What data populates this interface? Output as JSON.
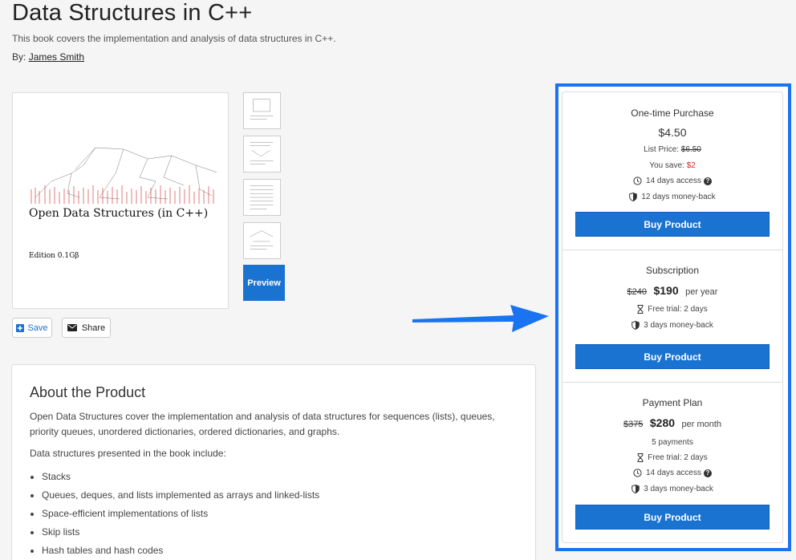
{
  "header": {
    "title": "Data Structures in C++",
    "subtitle": "This book covers the implementation and analysis of data structures in C++.",
    "author_prefix": "By:",
    "author": "James Smith"
  },
  "cover": {
    "title": "Open Data Structures (in C++)",
    "edition": "Edition 0.1Gβ"
  },
  "gallery": {
    "preview_label": "Preview"
  },
  "actions": {
    "save_label": "Save",
    "share_label": "Share"
  },
  "about": {
    "heading": "About the Product",
    "description": "Open Data Structures cover the implementation and analysis of data structures for sequences (lists), queues, priority queues, unordered dictionaries, ordered dictionaries, and graphs.",
    "list_intro": "Data structures presented in the book include:",
    "items": [
      "Stacks",
      "Queues, deques, and lists implemented as arrays and linked-lists",
      "Space-efficient implementations of lists",
      "Skip lists",
      "Hash tables and hash codes"
    ]
  },
  "pricing": {
    "accent": "#1a73d1",
    "one_time": {
      "name": "One-time Purchase",
      "price": "$4.50",
      "list_price_label": "List Price:",
      "list_price": "$6.50",
      "you_save_label": "You save:",
      "you_save": "$2",
      "access": "14 days access",
      "money_back": "12 days money-back",
      "button": "Buy Product"
    },
    "subscription": {
      "name": "Subscription",
      "old_price": "$240",
      "price": "$190",
      "period": "per year",
      "trial": "Free trial: 2 days",
      "money_back": "3 days money-back",
      "button": "Buy Product"
    },
    "payment_plan": {
      "name": "Payment Plan",
      "old_price": "$375",
      "price": "$280",
      "period": "per month",
      "payments": "5 payments",
      "trial": "Free trial: 2 days",
      "access": "14 days access",
      "money_back": "3 days money-back",
      "button": "Buy Product"
    }
  }
}
